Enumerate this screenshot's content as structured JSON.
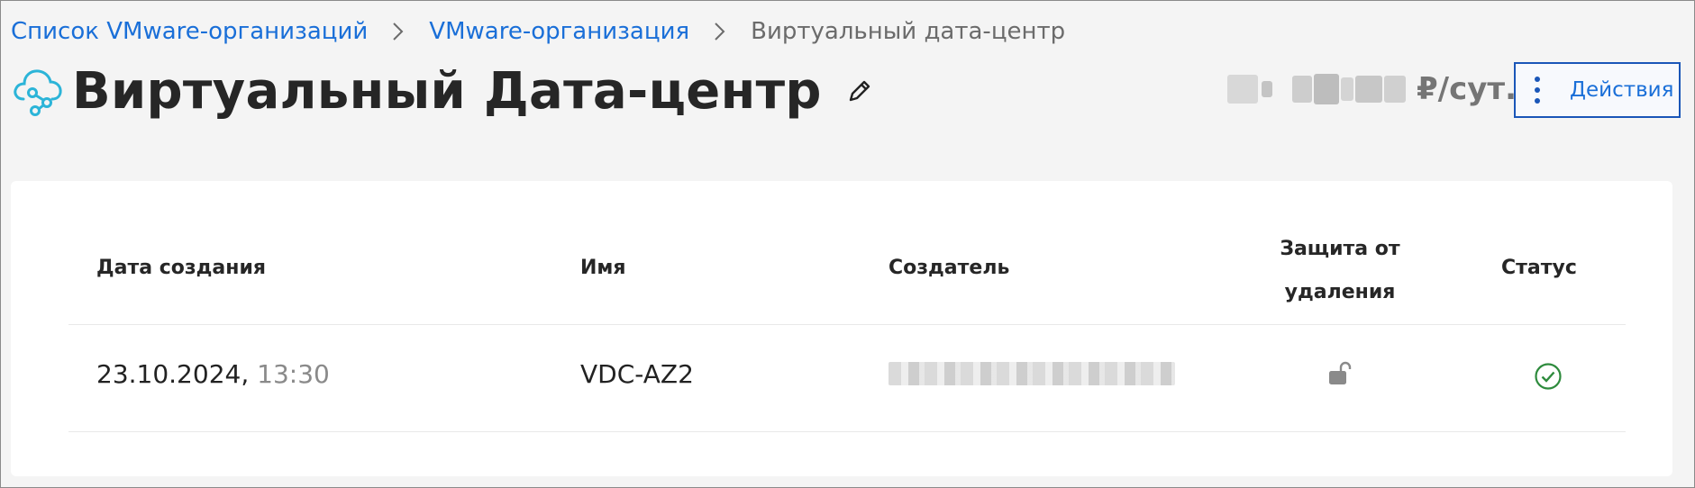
{
  "breadcrumb": {
    "items": [
      "Список VMware-организаций",
      "VMware-организация"
    ],
    "current": "Виртуальный дата-центр"
  },
  "header": {
    "title": "Виртуальный Дата-центр",
    "price_suffix": "₽/сут.",
    "actions_label": "Действия"
  },
  "table": {
    "columns": {
      "created": "Дата создания",
      "name": "Имя",
      "creator": "Создатель",
      "protection_line1": "Защита от",
      "protection_line2": "удаления",
      "status": "Статус"
    },
    "rows": [
      {
        "date": "23.10.2024,",
        "time": "13:30",
        "name": "VDC-AZ2",
        "protection": "unlocked",
        "status": "ok"
      }
    ]
  },
  "icons": {
    "title": "cloud-network-icon",
    "edit": "pencil-icon",
    "actions": "kebab-menu-icon",
    "protection": "unlocked-padlock-icon",
    "status": "check-circle-icon"
  },
  "colors": {
    "link": "#1a6fd8",
    "button_border": "#1a56b8",
    "icon_teal": "#2bb4d8",
    "status_ok": "#2e8b3d"
  }
}
